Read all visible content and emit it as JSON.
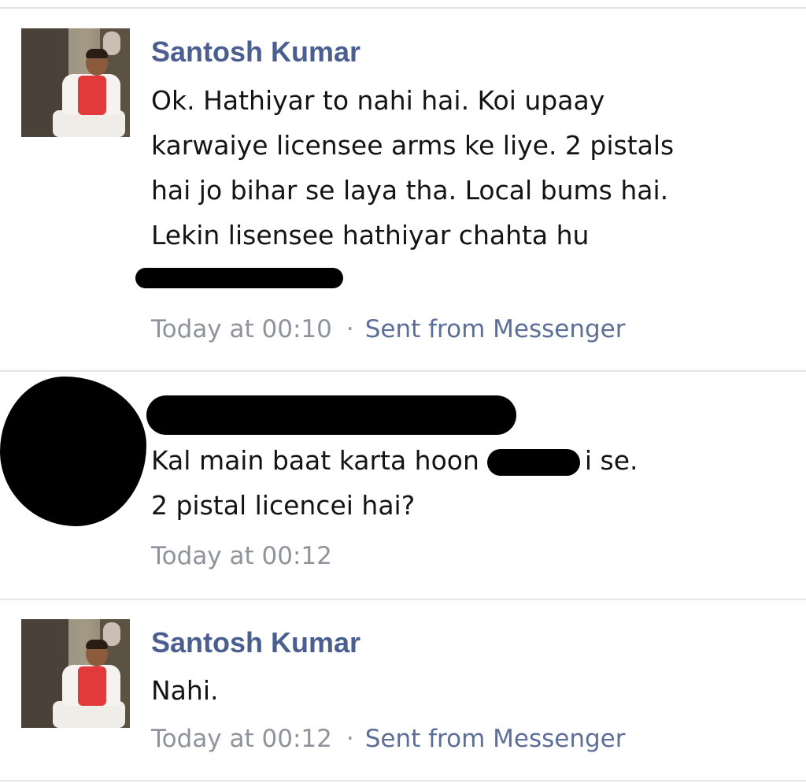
{
  "messages": [
    {
      "sender": "Santosh Kumar",
      "lines": [
        "Ok. Hathiyar to nahi hai. Koi upaay",
        "karwaiye licensee arms ke liye. 2 pistals",
        "hai jo bihar se laya tha. Local bums hai.",
        "Lekin lisensee hathiyar chahta hu"
      ],
      "time": "Today at 00:10",
      "separator": "·",
      "via": "Sent from Messenger"
    },
    {
      "line1_before": "Kal main baat karta hoon",
      "line1_after": "i se.",
      "line2": "2 pistal licencei hai?",
      "time": "Today at 00:12"
    },
    {
      "sender": "Santosh Kumar",
      "lines": [
        "Nahi."
      ],
      "time": "Today at 00:12",
      "separator": "·",
      "via": "Sent from Messenger"
    }
  ],
  "icons": {
    "avatar": "profile-photo"
  }
}
